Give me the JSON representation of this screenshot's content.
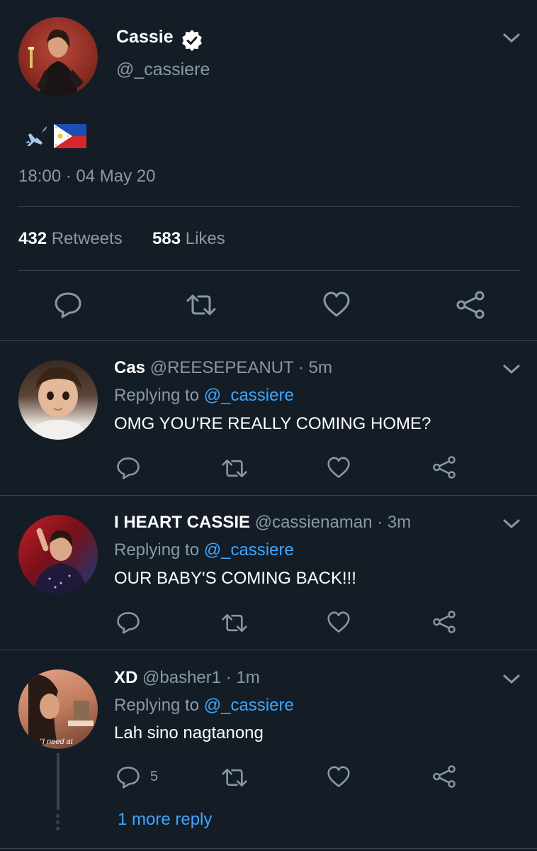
{
  "main_tweet": {
    "display_name": "Cassie",
    "handle": "@_cassiere",
    "timestamp": "18:00 · 04 May 20",
    "retweets_count": "432",
    "retweets_label": "Retweets",
    "likes_count": "583",
    "likes_label": "Likes",
    "content_icons": [
      "airplane-icon",
      "philippines-flag-icon"
    ]
  },
  "replies": [
    {
      "display_name": "Cas",
      "handle_time": "@REESEPEANUT · 5m",
      "replying_prefix": "Replying to",
      "replying_to": "@_cassiere",
      "text": "OMG YOU'RE REALLY COMING HOME?",
      "reply_count": ""
    },
    {
      "display_name": "I HEART CASSIE",
      "handle_time": "@cassienaman · 3m",
      "replying_prefix": "Replying to",
      "replying_to": "@_cassiere",
      "text": "OUR BABY'S COMING BACK!!!",
      "reply_count": ""
    },
    {
      "display_name": "XD",
      "handle_time": "@basher1 · 1m",
      "replying_prefix": "Replying to",
      "replying_to": "@_cassiere",
      "text": "Lah sino nagtanong",
      "reply_count": "5",
      "avatar_caption": "\"I need at"
    }
  ],
  "more_replies_link": "1 more reply",
  "colors": {
    "background": "#141d26",
    "divider": "#38444d",
    "muted_text": "#8899a6",
    "link": "#3ea6ff",
    "verified_badge": "#ffffff"
  }
}
